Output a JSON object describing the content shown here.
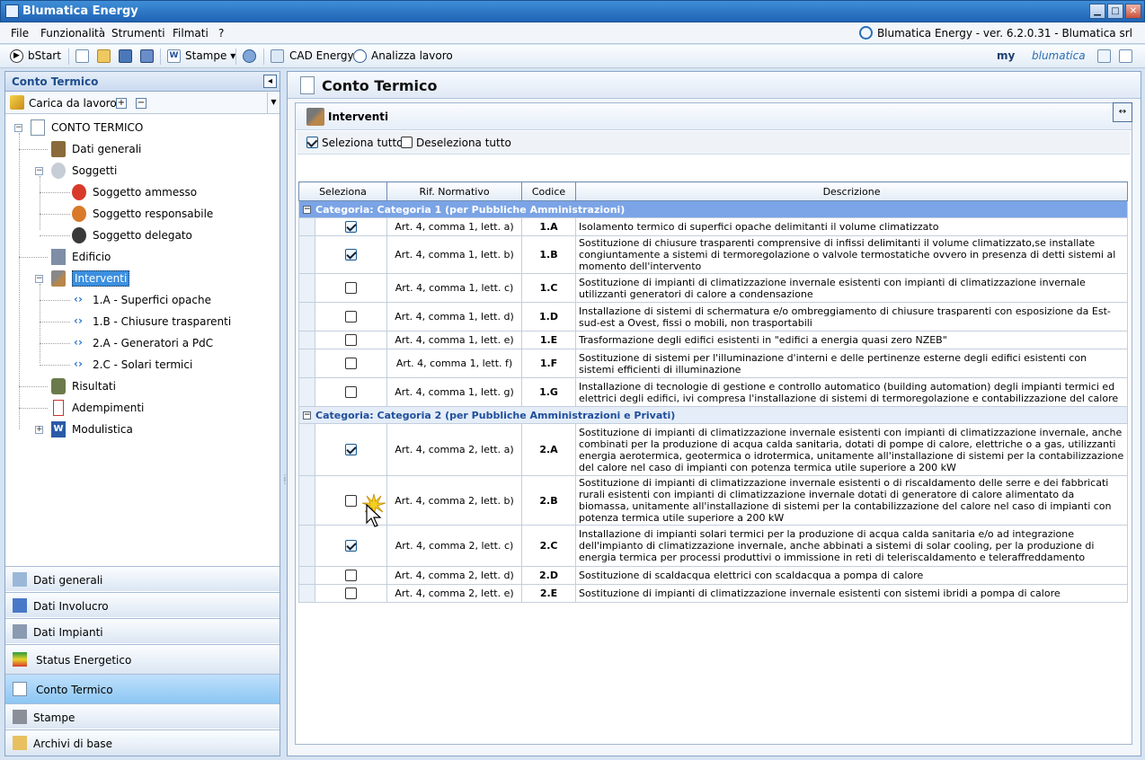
{
  "window": {
    "title": "Blumatica Energy"
  },
  "menu": {
    "items": [
      "File",
      "Funzionalità",
      "Strumenti",
      "Filmati",
      "?"
    ],
    "version": "Blumatica Energy - ver. 6.2.0.31 - Blumatica srl"
  },
  "toolbar": {
    "bstart": "bStart",
    "stampe": "Stampe",
    "cad": "CAD Energy",
    "analizza": "Analizza lavoro",
    "brand_my": "my",
    "brand_name": "blumatica"
  },
  "left": {
    "header": "Conto Termico",
    "combo": "Carica da lavoro",
    "tree": {
      "root": "CONTO TERMICO",
      "dati_generali": "Dati generali",
      "soggetti": "Soggetti",
      "soggetto_ammesso": "Soggetto ammesso",
      "soggetto_responsabile": "Soggetto responsabile",
      "soggetto_delegato": "Soggetto delegato",
      "edificio": "Edificio",
      "interventi": "Interventi",
      "int_1a": "1.A - Superfici opache",
      "int_1b": "1.B - Chiusure trasparenti",
      "int_2a": "2.A - Generatori a PdC",
      "int_2c": "2.C - Solari termici",
      "risultati": "Risultati",
      "adempimenti": "Adempimenti",
      "modulistica": "Modulistica"
    },
    "nav": [
      "Dati generali",
      "Dati Involucro",
      "Dati Impianti",
      "Status Energetico",
      "Conto Termico",
      "Stampe",
      "Archivi di base"
    ]
  },
  "right": {
    "title": "Conto Termico",
    "section": "Interventi",
    "select_all": "Seleziona tutto",
    "deselect_all": "Deseleziona tutto",
    "columns": [
      "Seleziona",
      "Rif. Normativo",
      "Codice",
      "Descrizione"
    ],
    "categories": [
      {
        "label": "Categoria: Categoria 1 (per Pubbliche Amministrazioni)",
        "rows": [
          {
            "checked": true,
            "ref": "Art. 4, comma 1, lett. a)",
            "code": "1.A",
            "desc": "Isolamento termico di superfici opache delimitanti il volume climatizzato"
          },
          {
            "checked": true,
            "ref": "Art. 4, comma 1, lett. b)",
            "code": "1.B",
            "desc": "Sostituzione di chiusure trasparenti comprensive di infissi delimitanti il volume climatizzato,se installate congiuntamente a sistemi di termoregolazione o valvole termostatiche ovvero in presenza di detti sistemi al momento dell'intervento"
          },
          {
            "checked": false,
            "ref": "Art. 4, comma 1, lett. c)",
            "code": "1.C",
            "desc": "Sostituzione di impianti di climatizzazione invernale esistenti con impianti di climatizzazione invernale utilizzanti generatori di calore a condensazione"
          },
          {
            "checked": false,
            "ref": "Art. 4, comma 1, lett. d)",
            "code": "1.D",
            "desc": "Installazione di sistemi di schermatura e/o ombreggiamento di chiusure trasparenti con esposizione da Est-sud-est a Ovest, fissi o mobili, non trasportabili"
          },
          {
            "checked": false,
            "ref": "Art. 4, comma 1, lett. e)",
            "code": "1.E",
            "desc": "Trasformazione degli edifici esistenti in \"edifici a energia quasi zero NZEB\""
          },
          {
            "checked": false,
            "ref": "Art. 4, comma 1, lett. f)",
            "code": "1.F",
            "desc": "Sostituzione di sistemi per l'illuminazione d'interni e delle pertinenze esterne degli edifici esistenti con sistemi efficienti di illuminazione"
          },
          {
            "checked": false,
            "ref": "Art. 4, comma 1, lett. g)",
            "code": "1.G",
            "desc": "Installazione di tecnologie di gestione e controllo automatico (building automation) degli impianti termici ed elettrici degli edifici, ivi compresa l'installazione di sistemi di termoregolazione e contabilizzazione del calore"
          }
        ]
      },
      {
        "label": "Categoria: Categoria 2 (per Pubbliche Amministrazioni e Privati)",
        "rows": [
          {
            "checked": true,
            "ref": "Art. 4, comma 2, lett. a)",
            "code": "2.A",
            "desc": "Sostituzione di impianti di climatizzazione invernale esistenti con impianti di climatizzazione invernale, anche combinati per la produzione di acqua calda sanitaria, dotati di pompe di calore, elettriche o a gas, utilizzanti energia aerotermica, geotermica o idrotermica, unitamente all'installazione di sistemi per la contabilizzazione del calore nel caso di impianti con potenza termica utile superiore a 200 kW"
          },
          {
            "checked": false,
            "ref": "Art. 4, comma 2, lett. b)",
            "code": "2.B",
            "desc": "Sostituzione di impianti di climatizzazione invernale esistenti o di riscaldamento delle serre e dei fabbricati rurali esistenti con impianti di climatizzazione invernale dotati di generatore di calore alimentato da biomassa, unitamente all'installazione di sistemi per la contabilizzazione del calore nel caso di impianti con potenza termica utile superiore a 200 kW"
          },
          {
            "checked": true,
            "ref": "Art. 4, comma 2, lett. c)",
            "code": "2.C",
            "desc": "Installazione di impianti solari termici per la produzione di acqua calda sanitaria e/o ad integrazione dell'impianto di climatizzazione invernale, anche abbinati a sistemi di solar cooling, per la produzione di energia termica per processi produttivi o immissione in reti di teleriscaldamento e teleraffreddamento"
          },
          {
            "checked": false,
            "ref": "Art. 4, comma 2, lett. d)",
            "code": "2.D",
            "desc": "Sostituzione di scaldacqua elettrici con scaldacqua a pompa di calore"
          },
          {
            "checked": false,
            "ref": "Art. 4, comma 2, lett. e)",
            "code": "2.E",
            "desc": "Sostituzione di impianti di climatizzazione invernale esistenti con sistemi ibridi a pompa di calore"
          }
        ]
      }
    ]
  }
}
